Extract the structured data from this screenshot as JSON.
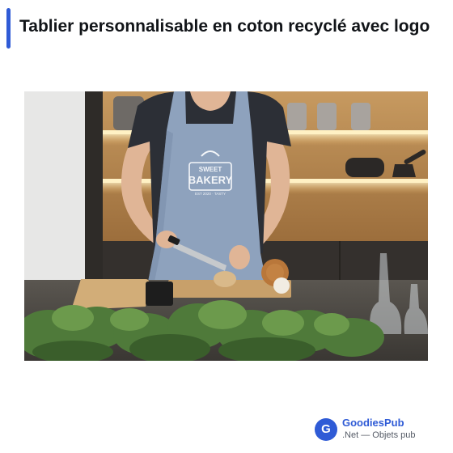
{
  "header": {
    "title": "Tablier personnalisable en coton recyclé avec logo"
  },
  "product_image": {
    "alt": "Tablier bleu chambray avec logo Sweet Bakery porté par une personne coupant des oignons en cuisine",
    "apron_logo": {
      "line1": "SWEET",
      "line2": "BAKERY",
      "line3": "EST 2020 · TASTY"
    },
    "colors": {
      "apron": "#8ea2bd",
      "shirt": "#2c2f36",
      "wood": "#b98e5a"
    }
  },
  "brand": {
    "logo_letter": "G",
    "name": "GoodiesPub",
    "tagline": ".Net — Objets pub",
    "color": "#2f5bd6"
  }
}
